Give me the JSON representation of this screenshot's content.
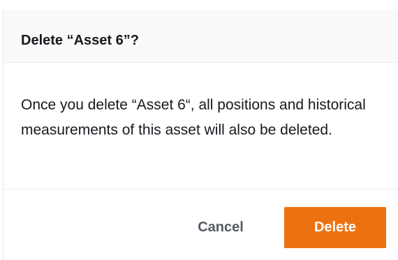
{
  "dialog": {
    "title": "Delete “Asset 6”?",
    "message": "Once you delete “Asset 6“, all positions and historical measurements of this asset will also be deleted.",
    "cancel_label": "Cancel",
    "delete_label": "Delete"
  },
  "colors": {
    "primary_button": "#ec7211",
    "header_background": "#fafafa",
    "text": "#16191f",
    "secondary_text": "#545b64"
  }
}
